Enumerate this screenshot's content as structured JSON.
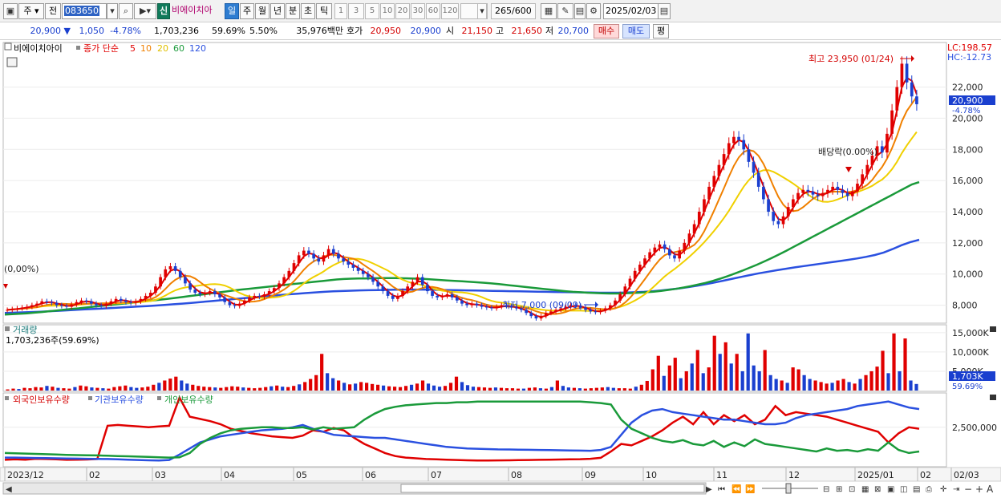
{
  "toolbar": {
    "market": "주",
    "mode": "전",
    "code": "083650",
    "badge": "신",
    "name": "비에이치아",
    "periods": [
      "일",
      "주",
      "월",
      "년",
      "분",
      "초",
      "틱"
    ],
    "selected_period": "일",
    "intervals": [
      "1",
      "3",
      "5",
      "10",
      "20",
      "30",
      "60",
      "120"
    ],
    "count": "265",
    "count_total": "/600",
    "date": "2025/02/03"
  },
  "quote": {
    "price": "20,900 ▼",
    "change": "1,050",
    "change_pct": "-4.78%",
    "volume": "1,703,236",
    "volume_ratio": "59.69%",
    "turnover": "5.50%",
    "amount": "35,976백만",
    "ask_label": "호가",
    "ask": "20,950",
    "bid": "20,900",
    "open_label": "시",
    "open": "21,150",
    "high_label": "고",
    "high": "21,650",
    "low_label": "저",
    "low": "20,700",
    "buy_label": "매수",
    "sell_label": "매도",
    "avg_label": "평"
  },
  "chart_data": [
    {
      "type": "candlestick",
      "panel": "price",
      "legend": [
        "비에이치아이",
        "종가 단순",
        "5",
        "10",
        "20",
        "60",
        "120"
      ],
      "colors": {
        "up": "#e00000",
        "down": "#1a3fcf",
        "ma5": "#e00000",
        "ma10": "#f08000",
        "ma20": "#f0d000",
        "ma60": "#1a9a3a",
        "ma120": "#2a50e0"
      },
      "ylim": [
        7000,
        24500
      ],
      "y_ticks": [
        "8,000",
        "10,000",
        "12,000",
        "14,000",
        "16,000",
        "18,000",
        "20,000",
        "22,000"
      ],
      "corner_labels": {
        "lc": "LC:198.57",
        "hc": "HC:-12.73"
      },
      "last_price_label": "20,900",
      "last_change_label": "-4.78%",
      "annotations": {
        "high": "최고 23,950 (01/24)",
        "low": "최저 7,000 (09/09)",
        "dividend": "배당락(0.00%)",
        "start": "(0,00%)"
      },
      "close_series": [
        7700,
        7750,
        7800,
        7850,
        7900,
        8000,
        8100,
        8250,
        8200,
        8150,
        8000,
        7950,
        7900,
        8050,
        8200,
        8300,
        8250,
        8100,
        8000,
        7950,
        8100,
        8250,
        8400,
        8300,
        8200,
        8150,
        8250,
        8400,
        8600,
        8800,
        9200,
        9800,
        10300,
        10500,
        10200,
        9800,
        9400,
        9000,
        8800,
        8700,
        8800,
        8900,
        8700,
        8500,
        8200,
        8000,
        7950,
        8100,
        8300,
        8500,
        8600,
        8550,
        8700,
        8900,
        9100,
        9400,
        9800,
        10200,
        10700,
        11200,
        11500,
        11300,
        11000,
        10800,
        11200,
        11600,
        11300,
        11000,
        10800,
        10600,
        10400,
        10200,
        10000,
        9800,
        9500,
        9200,
        8900,
        8600,
        8400,
        8600,
        8900,
        9200,
        9500,
        9800,
        9300,
        8900,
        8600,
        8500,
        8600,
        8700,
        8500,
        8300,
        8100,
        8000,
        8100,
        8000,
        7900,
        7850,
        7800,
        7900,
        8000,
        7950,
        7850,
        7800,
        7700,
        7500,
        7300,
        7150,
        7300,
        7500,
        7600,
        7700,
        7800,
        7900,
        8000,
        7950,
        7850,
        7700,
        7600,
        7550,
        7650,
        7800,
        8000,
        8300,
        8700,
        9200,
        9700,
        10200,
        10600,
        11000,
        11400,
        11700,
        11900,
        11600,
        11200,
        11000,
        11500,
        12000,
        12600,
        13200,
        14000,
        14800,
        15600,
        16300,
        17000,
        17700,
        18400,
        18800,
        18600,
        18000,
        17200,
        16500,
        15600,
        14800,
        14000,
        13400,
        13200,
        13700,
        14300,
        14800,
        15200,
        15400,
        15300,
        15100,
        15000,
        15200,
        15400,
        15600,
        15400,
        15200,
        15000,
        15300,
        15800,
        16400,
        17000,
        17600,
        18200,
        17800,
        19000,
        20500,
        22000,
        23500,
        22300,
        21400,
        20900
      ],
      "ma60_series": [
        7400,
        7420,
        7450,
        7480,
        7520,
        7560,
        7610,
        7660,
        7710,
        7760,
        7800,
        7850,
        7900,
        7950,
        8000,
        8050,
        8100,
        8150,
        8200,
        8250,
        8300,
        8350,
        8400,
        8460,
        8520,
        8580,
        8640,
        8700,
        8760,
        8820,
        8880,
        8940,
        9000,
        9050,
        9100,
        9150,
        9200,
        9250,
        9300,
        9350,
        9400,
        9450,
        9500,
        9550,
        9600,
        9650,
        9680,
        9700,
        9710,
        9720,
        9730,
        9740,
        9740,
        9740,
        9730,
        9720,
        9700,
        9680,
        9650,
        9620,
        9590,
        9560,
        9530,
        9500,
        9470,
        9440,
        9400,
        9350,
        9300,
        9250,
        9200,
        9150,
        9100,
        9050,
        9000,
        8950,
        8900,
        8860,
        8830,
        8800,
        8780,
        8760,
        8750,
        8750,
        8760,
        8780,
        8800,
        8830,
        8870,
        8920,
        8980,
        9050,
        9130,
        9220,
        9320,
        9430,
        9560,
        9700,
        9860,
        10030,
        10210,
        10400,
        10600,
        10810,
        11030,
        11260,
        11500,
        11750,
        12000,
        12250,
        12500,
        12750,
        13000,
        13250,
        13500,
        13750,
        14000,
        14250,
        14500,
        14750,
        15000,
        15250,
        15500,
        15750,
        15900
      ],
      "ma120_series": [
        7500,
        7520,
        7540,
        7560,
        7580,
        7610,
        7640,
        7670,
        7700,
        7730,
        7760,
        7790,
        7820,
        7850,
        7880,
        7910,
        7940,
        7980,
        8020,
        8060,
        8100,
        8150,
        8200,
        8250,
        8300,
        8350,
        8400,
        8450,
        8500,
        8550,
        8600,
        8650,
        8700,
        8740,
        8780,
        8820,
        8860,
        8890,
        8910,
        8930,
        8950,
        8960,
        8970,
        8980,
        8990,
        9000,
        9000,
        9000,
        8990,
        8980,
        8970,
        8960,
        8950,
        8940,
        8930,
        8920,
        8910,
        8900,
        8890,
        8880,
        8870,
        8860,
        8850,
        8840,
        8830,
        8820,
        8810,
        8800,
        8800,
        8800,
        8810,
        8830,
        8860,
        8900,
        8950,
        9010,
        9080,
        9160,
        9250,
        9350,
        9460,
        9580,
        9700,
        9820,
        9940,
        10050,
        10150,
        10250,
        10340,
        10430,
        10510,
        10590,
        10670,
        10750,
        10830,
        10910,
        11000,
        11100,
        11220,
        11380,
        11600,
        11850,
        12050,
        12200
      ]
    },
    {
      "type": "bar",
      "panel": "volume",
      "title": "거래량",
      "current": "1,703,236주(59.69%)",
      "ylim": [
        0,
        16000000
      ],
      "y_ticks": [
        "5,000K",
        "10,000K",
        "15,000K"
      ],
      "last_label": "1,703K",
      "last_ratio_label": "59.69%",
      "values": [
        300000,
        500000,
        400000,
        700000,
        600000,
        900000,
        800000,
        1200000,
        1000000,
        700000,
        600000,
        500000,
        900000,
        1300000,
        1100000,
        800000,
        700000,
        600000,
        500000,
        900000,
        1100000,
        1300000,
        900000,
        700000,
        800000,
        1000000,
        1500000,
        2000000,
        2600000,
        3100000,
        3600000,
        2600000,
        1800000,
        1500000,
        1200000,
        1000000,
        900000,
        800000,
        700000,
        900000,
        1100000,
        1000000,
        800000,
        700000,
        600000,
        700000,
        900000,
        1100000,
        1300000,
        1000000,
        900000,
        1200000,
        1600000,
        2200000,
        3000000,
        4000000,
        9500000,
        4500000,
        3200000,
        2600000,
        2000000,
        1600000,
        1800000,
        2200000,
        2000000,
        1700000,
        1500000,
        1300000,
        1100000,
        1000000,
        900000,
        1200000,
        1500000,
        1800000,
        2600000,
        1800000,
        1300000,
        1000000,
        1200000,
        2000000,
        3600000,
        2200000,
        1400000,
        1000000,
        900000,
        800000,
        700000,
        800000,
        700000,
        600000,
        600000,
        500000,
        500000,
        700000,
        800000,
        600000,
        500000,
        900000,
        2600000,
        1200000,
        800000,
        700000,
        600000,
        500000,
        600000,
        700000,
        800000,
        900000,
        700000,
        600000,
        600000,
        500000,
        1000000,
        1500000,
        2500000,
        5500000,
        9000000,
        3800000,
        6500000,
        8500000,
        3200000,
        5000000,
        7000000,
        10500000,
        4500000,
        6000000,
        14200000,
        9500000,
        12500000,
        7000000,
        9500000,
        5000000,
        14800000,
        6500000,
        5000000,
        10500000,
        4000000,
        3000000,
        2600000,
        2000000,
        6000000,
        5500000,
        4000000,
        3000000,
        2600000,
        2200000,
        1800000,
        2000000,
        2600000,
        3000000,
        2200000,
        1800000,
        3000000,
        4000000,
        5000000,
        6200000,
        10300000,
        4500000,
        14800000,
        5000000,
        13500000,
        2600000,
        1703236
      ]
    },
    {
      "type": "line",
      "panel": "holdings",
      "legend": [
        "외국인보유수량",
        "기관보유수량",
        "개인보유수량"
      ],
      "colors": {
        "foreign": "#e00000",
        "institution": "#2a50e0",
        "individual": "#1a9a3a"
      },
      "ylim": [
        0,
        4500000
      ],
      "y_ticks": [
        "2,500,000"
      ],
      "series": [
        {
          "name": "외국인보유수량",
          "values": [
            350000,
            380000,
            360000,
            420000,
            400000,
            380000,
            350000,
            360000,
            370000,
            400000,
            2600000,
            2650000,
            2600000,
            2550000,
            2500000,
            2550000,
            2600000,
            4450000,
            3200000,
            3050000,
            2900000,
            2700000,
            2400000,
            2250000,
            2100000,
            2000000,
            1900000,
            1850000,
            1800000,
            1950000,
            2300000,
            2200000,
            2450000,
            2300000,
            1800000,
            1400000,
            1100000,
            800000,
            600000,
            500000,
            450000,
            400000,
            380000,
            360000,
            340000,
            320000,
            300000,
            300000,
            310000,
            320000,
            330000,
            340000,
            350000,
            360000,
            370000,
            380000,
            390000,
            420000,
            480000,
            900000,
            1400000,
            1300000,
            1600000,
            1900000,
            2300000,
            2800000,
            3200000,
            2700000,
            3500000,
            2700000,
            3300000,
            2900000,
            3300000,
            2700000,
            3000000,
            3900000,
            3300000,
            3500000,
            3400000,
            3300000,
            3200000,
            3000000,
            2800000,
            2600000,
            2400000,
            2200000,
            1500000,
            2100000,
            2500000,
            2400000
          ]
        },
        {
          "name": "기관보유수량",
          "values": [
            500000,
            500000,
            480000,
            470000,
            460000,
            450000,
            440000,
            430000,
            420000,
            410000,
            400000,
            380000,
            360000,
            340000,
            320000,
            300000,
            340000,
            700000,
            1100000,
            1500000,
            1700000,
            1900000,
            2000000,
            2100000,
            2200000,
            2300000,
            2350000,
            2400000,
            2500000,
            2650000,
            2400000,
            2200000,
            2000000,
            1950000,
            1900000,
            1850000,
            1800000,
            1800000,
            1700000,
            1600000,
            1500000,
            1400000,
            1300000,
            1200000,
            1150000,
            1100000,
            1080000,
            1060000,
            1040000,
            1030000,
            1020000,
            1010000,
            1000000,
            990000,
            980000,
            970000,
            960000,
            950000,
            1000000,
            1200000,
            2000000,
            2800000,
            3300000,
            3600000,
            3700000,
            3500000,
            3400000,
            3300000,
            3200000,
            3100000,
            3000000,
            3000000,
            2900000,
            2800000,
            2700000,
            2700000,
            2800000,
            3100000,
            3300000,
            3400000,
            3500000,
            3600000,
            3700000,
            3900000,
            4000000,
            4100000,
            4200000,
            4000000,
            3800000,
            3700000
          ]
        },
        {
          "name": "개인보유수량",
          "values": [
            800000,
            780000,
            760000,
            740000,
            720000,
            700000,
            680000,
            660000,
            650000,
            640000,
            620000,
            600000,
            580000,
            560000,
            540000,
            520000,
            500000,
            520000,
            800000,
            1400000,
            1800000,
            2100000,
            2300000,
            2400000,
            2450000,
            2500000,
            2500000,
            2450000,
            2450000,
            2500000,
            2350000,
            2500000,
            2400000,
            2450000,
            2500000,
            3000000,
            3400000,
            3700000,
            3850000,
            3950000,
            4000000,
            4050000,
            4100000,
            4100000,
            4150000,
            4150000,
            4200000,
            4200000,
            4200000,
            4200000,
            4200000,
            4200000,
            4200000,
            4200000,
            4200000,
            4200000,
            4200000,
            4150000,
            4100000,
            4000000,
            3000000,
            2400000,
            2100000,
            1800000,
            1600000,
            1500000,
            1650000,
            1400000,
            1300000,
            1600000,
            1200000,
            1500000,
            1250000,
            1700000,
            1400000,
            1300000,
            1200000,
            1100000,
            1000000,
            900000,
            1100000,
            950000,
            1000000,
            900000,
            1050000,
            950000,
            1500000,
            1000000,
            800000,
            900000
          ]
        }
      ]
    }
  ],
  "x_axis": {
    "labels": [
      "2023/12",
      "02",
      "03",
      "04",
      "05",
      "06",
      "07",
      "08",
      "09",
      "10",
      "11",
      "12",
      "2025/01",
      "02",
      "02/03"
    ]
  }
}
